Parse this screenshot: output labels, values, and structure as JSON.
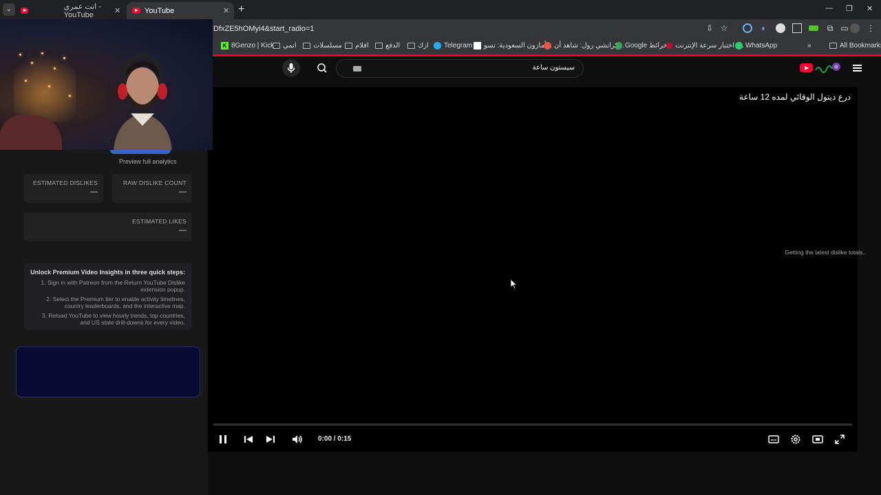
{
  "browser": {
    "tabs": [
      {
        "label": "انت عمري - YouTube",
        "active": false
      },
      {
        "label": "YouTube",
        "active": true
      }
    ],
    "url": "DfxZE5hOMyi4&start_radio=1",
    "bookmarks": [
      "8Genzo | Kick",
      "انمي",
      "مسلسلات",
      "افلام",
      "الدفع",
      "ازك",
      "Telegram",
      "أمازون السعودية: تسو...",
      "كرانشي رول: شاهد أن...",
      "Google خرائط",
      "اختبار سرعة الإنترنت |...",
      "WhatsApp"
    ],
    "all_bookmarks": "All Bookmarks"
  },
  "youtube": {
    "search_value": "سيستون ساعة",
    "video_title": "درع ديتول الوقائي لمده 12 ساعة",
    "time": "0:00 / 0:15",
    "progress": 0
  },
  "panel": {
    "preview_link": "Preview full analytics",
    "estimated_dislikes_label": "ESTIMATED DISLIKES",
    "estimated_dislikes_value": "—",
    "raw_dislike_label": "RAW DISLIKE COUNT",
    "raw_dislike_value": "—",
    "estimated_likes_label": "ESTIMATED LIKES",
    "estimated_likes_value": "—",
    "note": "Getting the latest dislike totals..",
    "premium_title": "Unlock Premium Video Insights in three quick steps:",
    "premium_steps": [
      "1. Sign in with Patreon from the Return YouTube Dislike extension popup.",
      "2. Select the Premium tier to enable activity timelines, country leaderboards, and the interactive map.",
      "3. Reload YouTube to view hourly trends, top countries, and US state drill-downs for every video."
    ]
  },
  "colors": {
    "accent": "#ff0033",
    "panel_bg": "#181818",
    "player_bg": "#000000"
  }
}
